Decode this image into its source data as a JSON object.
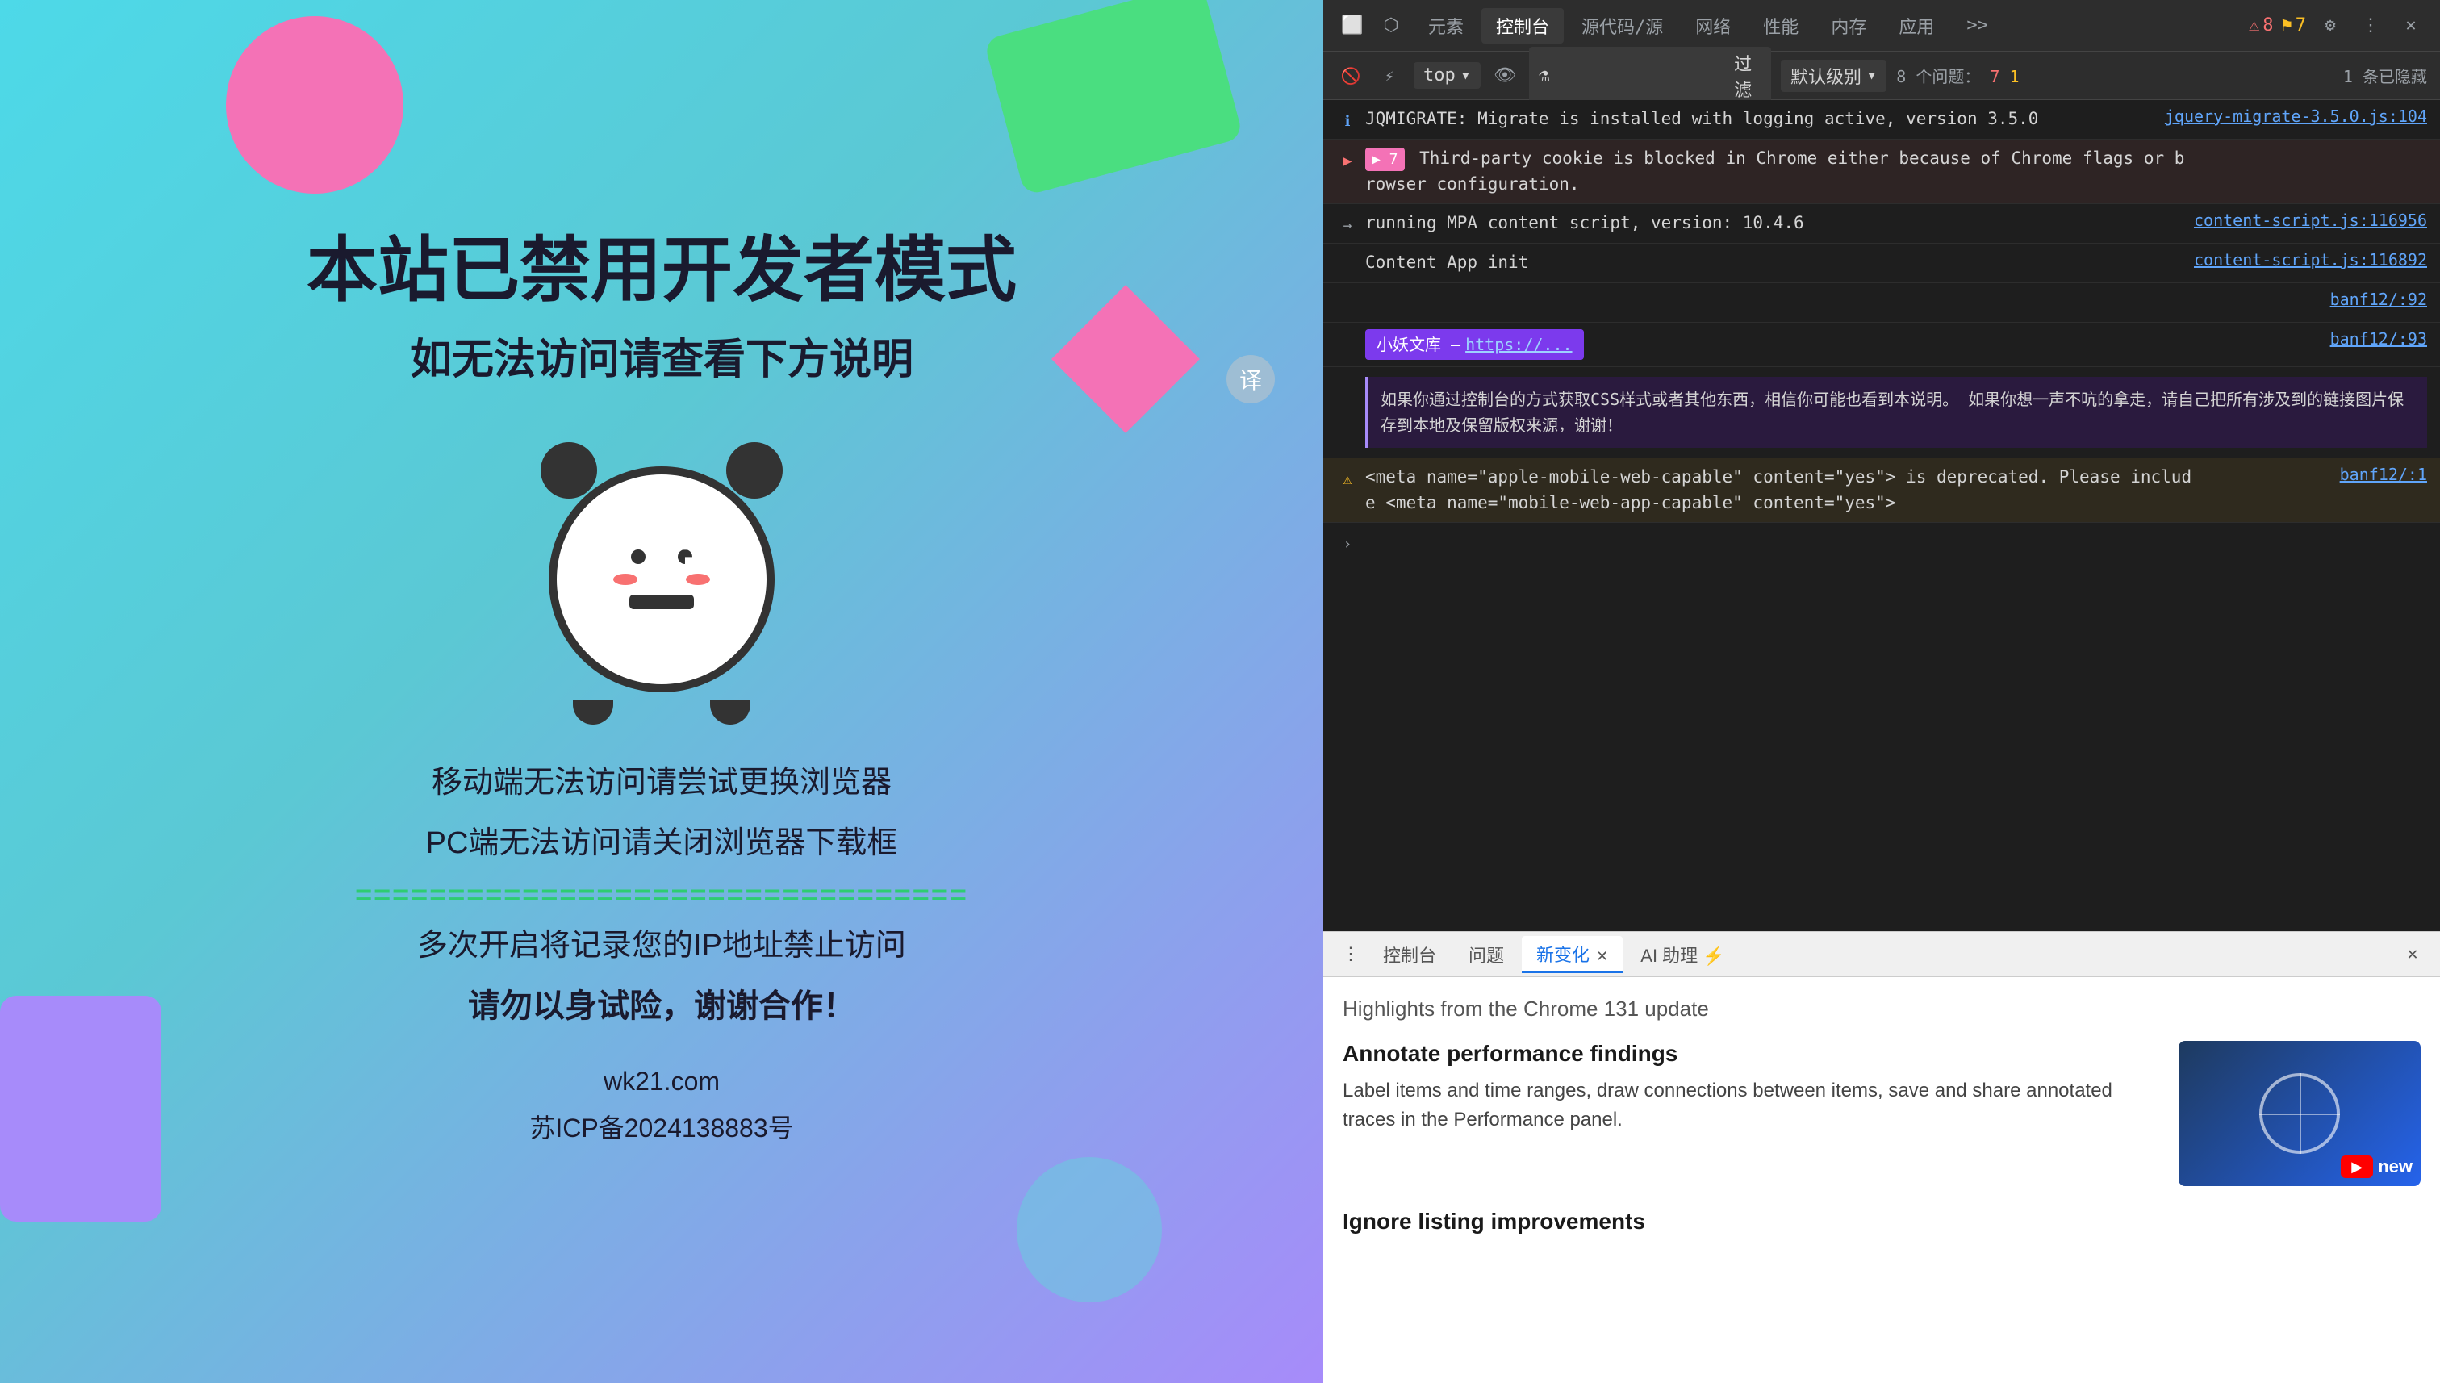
{
  "webpage": {
    "main_title": "本站已禁用开发者模式",
    "sub_title": "如无法访问请查看下方说明",
    "mobile_text": "移动端无法访问请尝试更换浏览器",
    "pc_text": "PC端无法访问请关闭浏览器下载框",
    "divider": "=================================",
    "warning1": "多次开启将记录您的IP地址禁止访问",
    "warning2": "请勿以身试险，谢谢合作！",
    "footer_domain": "wk21.com",
    "footer_icp": "苏ICP备2024138883号"
  },
  "devtools": {
    "tabs": [
      {
        "label": "元素",
        "active": false
      },
      {
        "label": "控制台",
        "active": true
      },
      {
        "label": "源代码/源",
        "active": false
      },
      {
        "label": "网络",
        "active": false
      },
      {
        "label": "性能",
        "active": false
      },
      {
        "label": "内存",
        "active": false
      },
      {
        "label": "应用",
        "active": false
      }
    ],
    "more_tabs": ">>",
    "error_count": "8",
    "warning_count": "7",
    "top_label": "top",
    "filter_placeholder": "过滤",
    "level_label": "默认级别",
    "issues_label": "8 个问题：",
    "issues_error": "7",
    "issues_warning": "1",
    "hidden_label": "1 条已隐藏",
    "console_rows": [
      {
        "type": "info",
        "message": "JQMIGRATE: Migrate is installed with logging active, version 3.5.0",
        "source": "jquery-migrate-3.5.0.js:104"
      },
      {
        "type": "error",
        "badge": "▶ 7",
        "message": "Third-party cookie is blocked in Chrome either because of Chrome flags or browser configuration.",
        "source": ""
      },
      {
        "type": "info",
        "arrow": "→",
        "message": "running MPA content script, version: 10.4.6",
        "source": "content-script.js:116956"
      },
      {
        "type": "info",
        "message": "Content App init",
        "source": "content-script.js:116892"
      },
      {
        "type": "info",
        "message": "",
        "source": "banf12/:92"
      },
      {
        "type": "special",
        "label": "小妖文库 – https://...",
        "source": "banf12/:93"
      },
      {
        "type": "special_msg",
        "message": "如果你通过控制台的方式获取CSS样式或者其他东西，相信你可能也看到本说明。 如果你想一声不吭的拿走，请自己把所有涉及到的链接图片保存到本地及保留版权来源，谢谢！",
        "source": ""
      },
      {
        "type": "warn",
        "message": "<meta name=\"apple-mobile-web-capable\" content=\"yes\"> is deprecated. Please include <meta name=\"mobile-web-app-capable\" content=\"yes\">",
        "source": "banf12/:1"
      },
      {
        "type": "info",
        "message": ">",
        "source": ""
      }
    ],
    "bottom_tabs": [
      {
        "label": "控制台",
        "active": false
      },
      {
        "label": "问题",
        "active": false
      },
      {
        "label": "新变化",
        "active": true
      },
      {
        "label": "AI 助理 ⚡",
        "active": false
      }
    ],
    "highlights_title": "Highlights from the Chrome 131 update",
    "feature1_heading": "Annotate performance findings",
    "feature1_desc": "Label items and time ranges, draw connections between items, save and share annotated traces in the Performance panel.",
    "feature2_heading": "Ignore listing improvements",
    "new_badge": "new"
  }
}
